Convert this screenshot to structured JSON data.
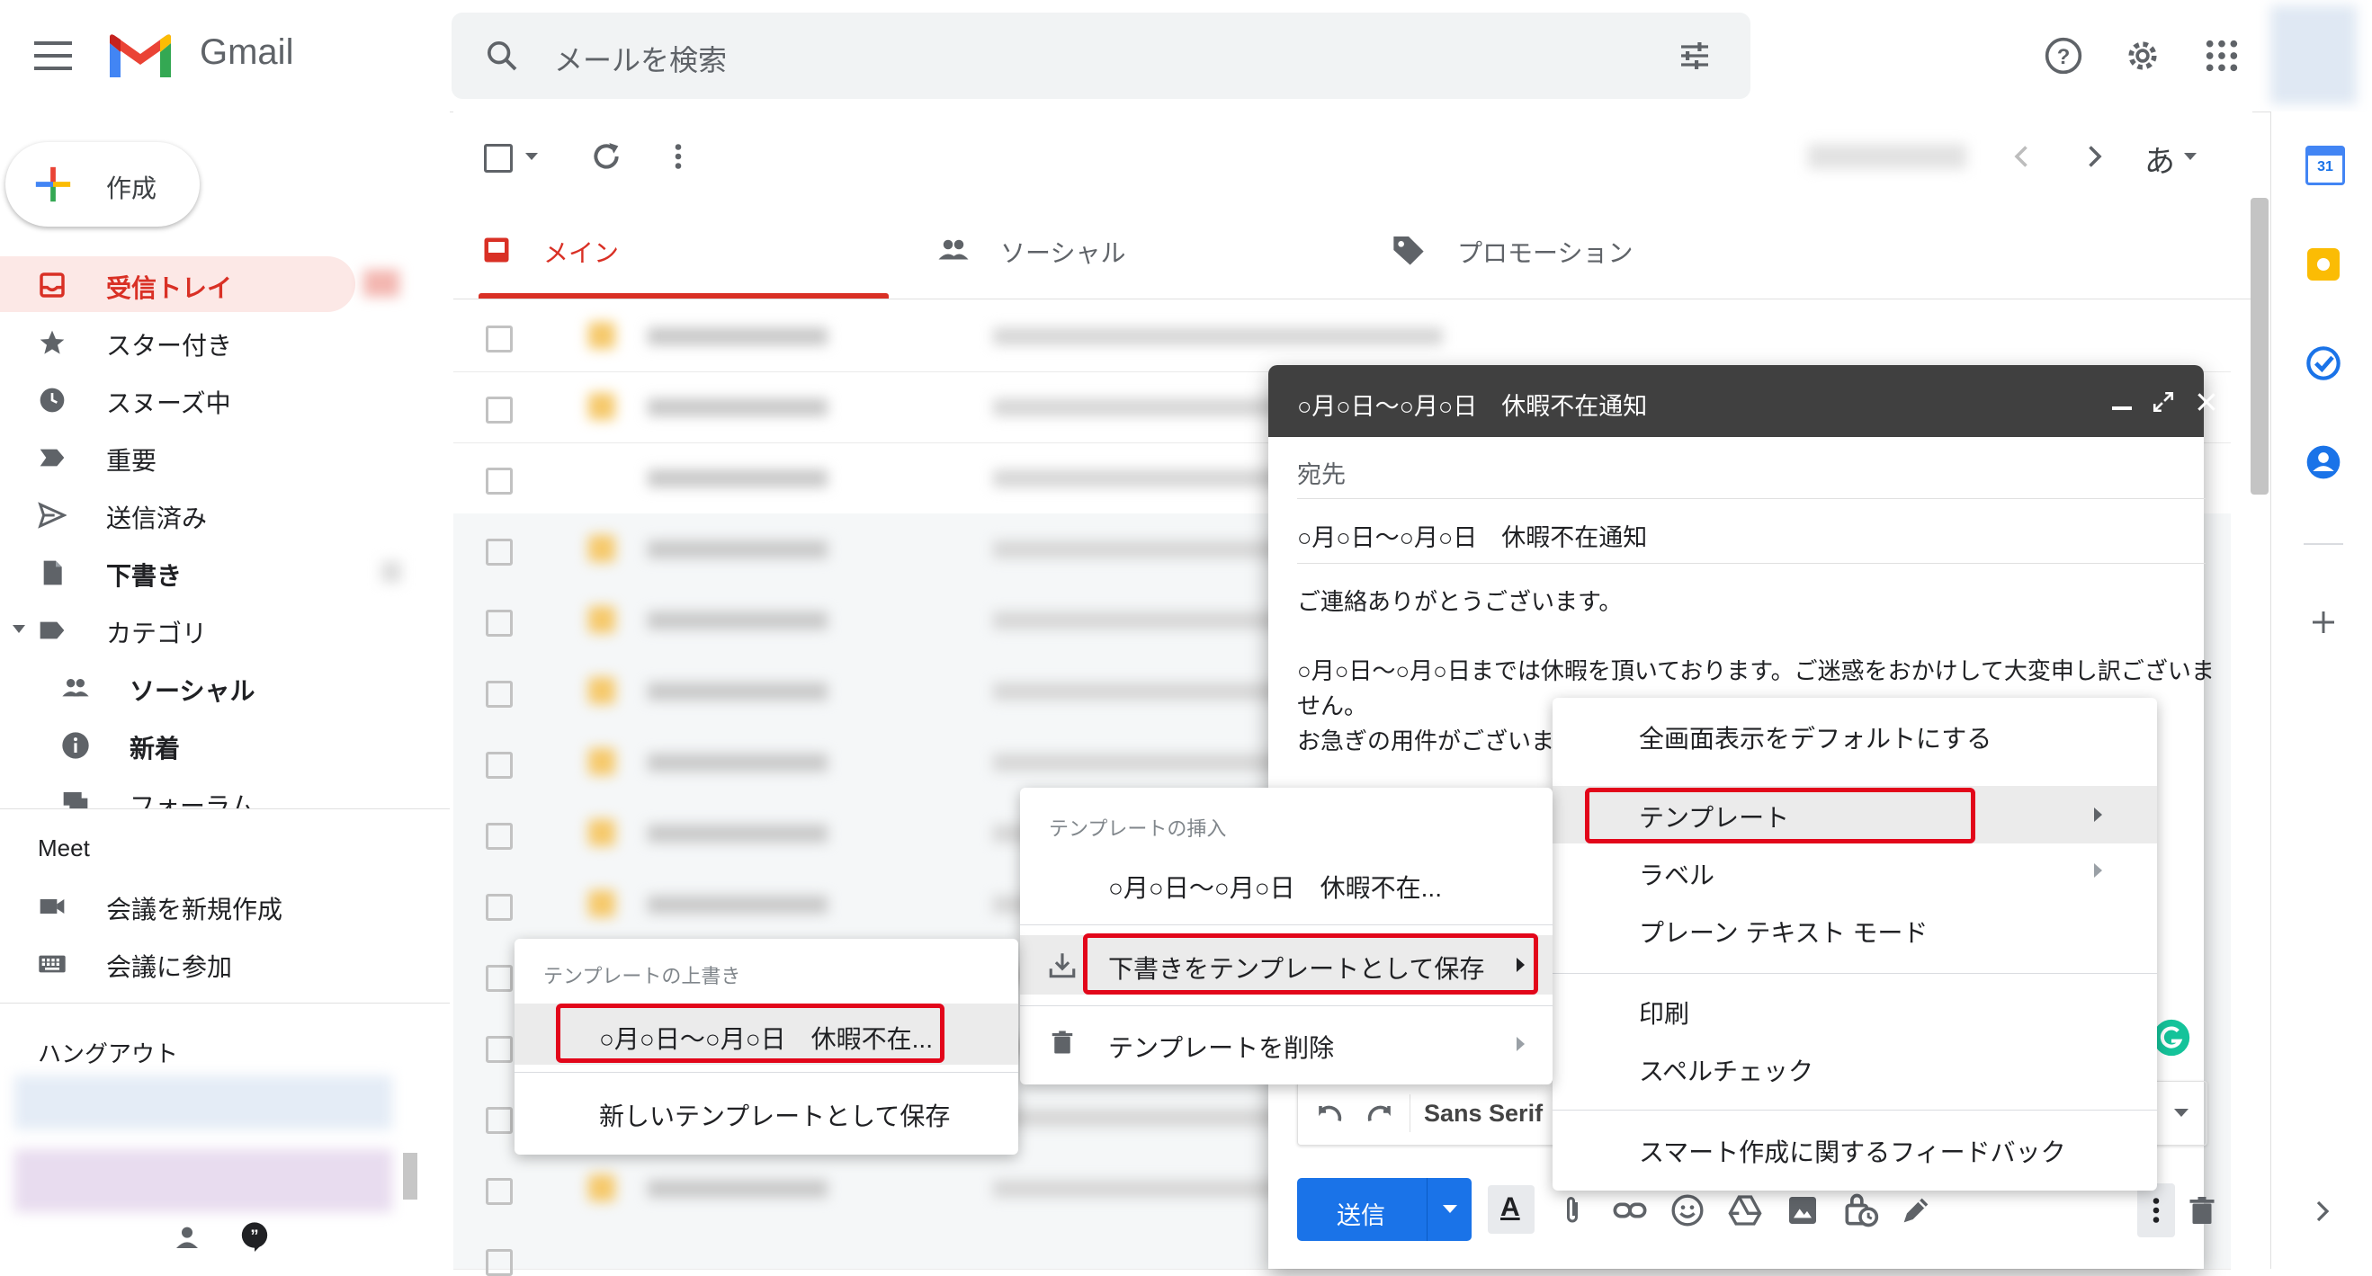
{
  "header": {
    "app_name": "Gmail",
    "search_placeholder": "メールを検索"
  },
  "compose_button": "作成",
  "sidebar": {
    "items": [
      {
        "label": "受信トレイ",
        "icon": "inbox-icon"
      },
      {
        "label": "スター付き",
        "icon": "star-icon"
      },
      {
        "label": "スヌーズ中",
        "icon": "clock-icon"
      },
      {
        "label": "重要",
        "icon": "important-icon"
      },
      {
        "label": "送信済み",
        "icon": "send-icon"
      },
      {
        "label": "下書き",
        "icon": "draft-icon"
      },
      {
        "label": "カテゴリ",
        "icon": "label-icon"
      },
      {
        "label": "ソーシャル",
        "icon": "people-icon"
      },
      {
        "label": "新着",
        "icon": "info-icon"
      },
      {
        "label": "フォーラム",
        "icon": "forum-icon"
      }
    ],
    "meet_title": "Meet",
    "meet_items": [
      "会議を新規作成",
      "会議に参加"
    ],
    "hangouts_title": "ハングアウト"
  },
  "toolbar": {
    "ime": "あ"
  },
  "tabs": [
    {
      "label": "メイン"
    },
    {
      "label": "ソーシャル"
    },
    {
      "label": "プロモーション"
    }
  ],
  "compose": {
    "title": "○月○日〜○月○日　休暇不在通知",
    "to_label": "宛先",
    "subject": "○月○日〜○月○日　休暇不在通知",
    "body": {
      "line1": "ご連絡ありがとうございます。",
      "line2": "○月○日〜○月○日までは休暇を頂いております。ご迷惑をおかけして大変申し訳ございま",
      "line3": "せん。",
      "line4": "お急ぎの用件がございま"
    },
    "font": "Sans Serif",
    "send": "送信"
  },
  "more_menu": {
    "items": [
      "全画面表示をデフォルトにする",
      "テンプレート",
      "ラベル",
      "プレーン テキスト モード",
      "印刷",
      "スペルチェック",
      "スマート作成に関するフィードバック"
    ]
  },
  "template_menu": {
    "insert_header": "テンプレートの挿入",
    "insert_item": "○月○日〜○月○日　休暇不在...",
    "save_item": "下書きをテンプレートとして保存",
    "delete_item": "テンプレートを削除"
  },
  "overwrite_menu": {
    "header": "テンプレートの上書き",
    "item": "○月○日〜○月○日　休暇不在...",
    "new_item": "新しいテンプレートとして保存"
  },
  "side_panel": {
    "calendar_day": "31"
  },
  "colors": {
    "highlight": "#e2061a",
    "active_red": "#d93025",
    "send_blue": "#1a73e8",
    "compose_header": "#404040"
  }
}
